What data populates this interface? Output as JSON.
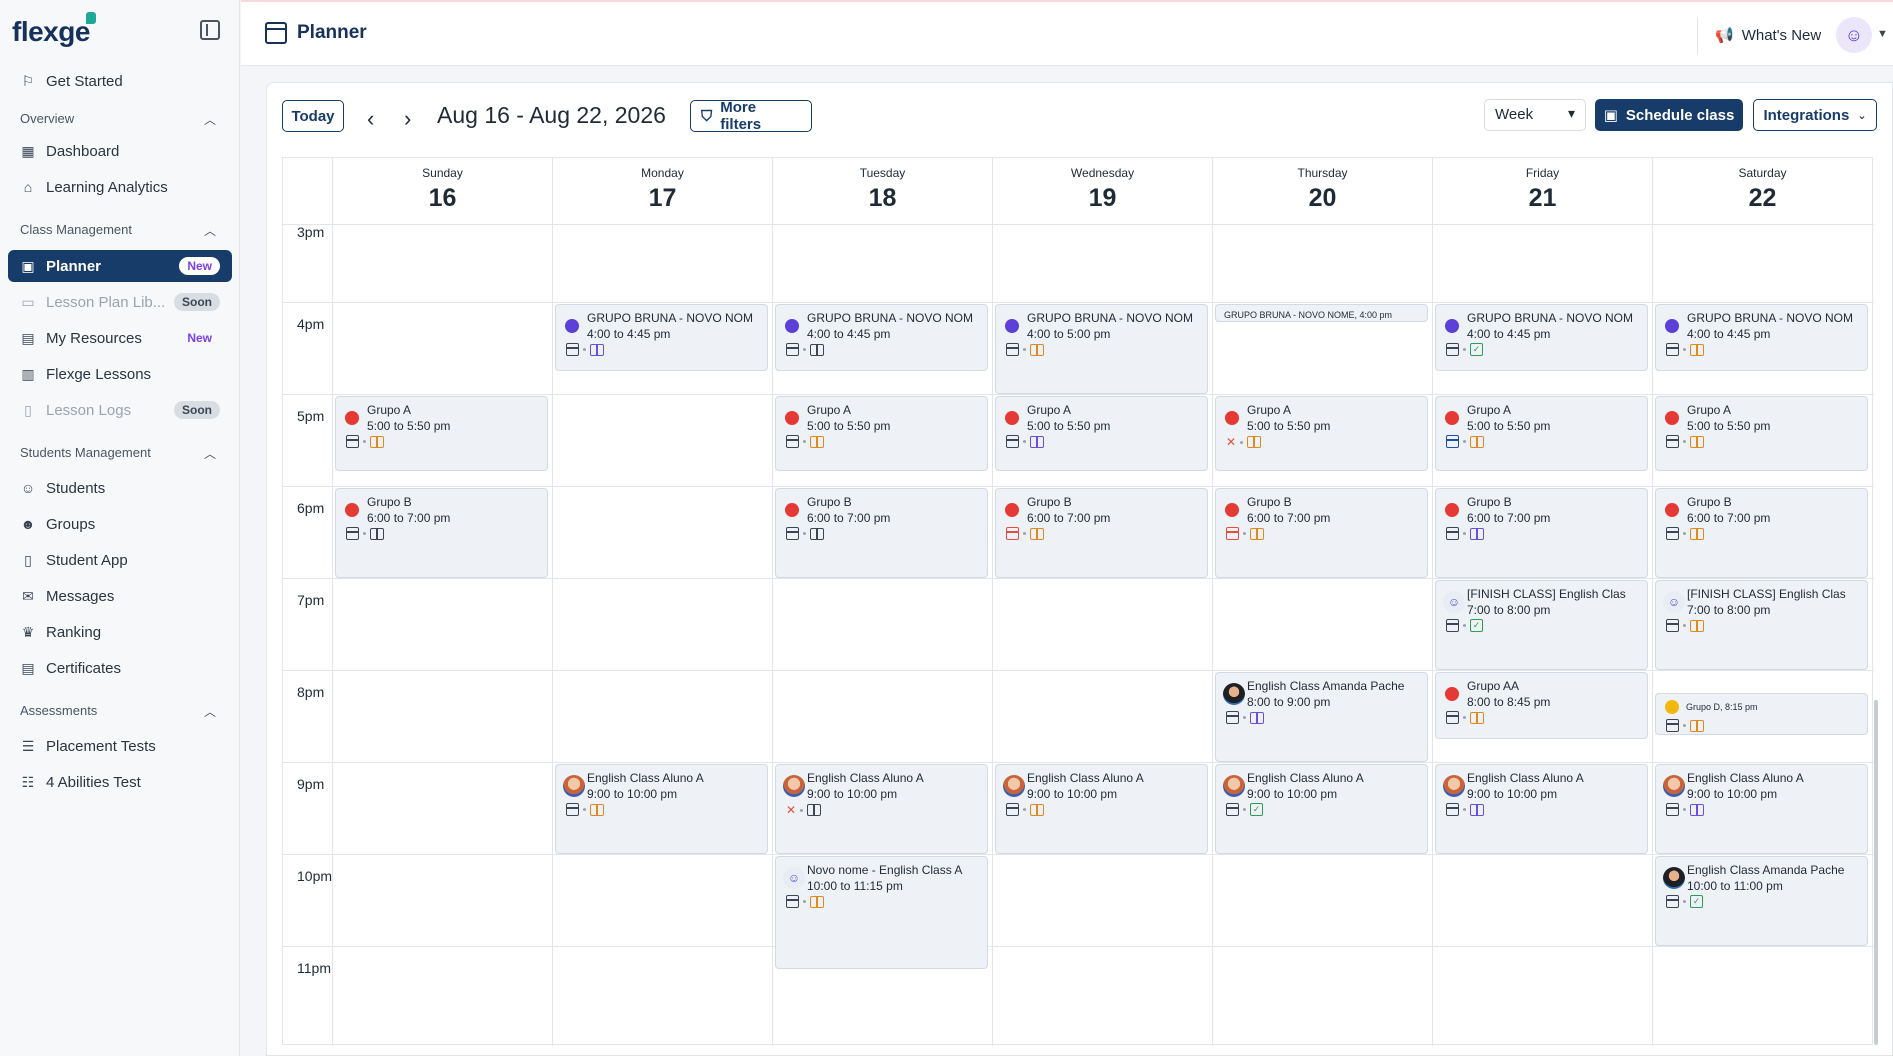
{
  "brand": {
    "name": "flexge"
  },
  "sidebar": {
    "get_started": "Get Started",
    "sections": [
      {
        "title": "Overview",
        "items": [
          {
            "label": "Dashboard"
          },
          {
            "label": "Learning Analytics"
          }
        ]
      },
      {
        "title": "Class Management",
        "items": [
          {
            "label": "Planner",
            "badge": "New",
            "active": true
          },
          {
            "label": "Lesson Plan Lib...",
            "badge": "Soon",
            "disabled": true
          },
          {
            "label": "My Resources",
            "badge": "New"
          },
          {
            "label": "Flexge Lessons"
          },
          {
            "label": "Lesson Logs",
            "badge": "Soon",
            "disabled": true
          }
        ]
      },
      {
        "title": "Students Management",
        "items": [
          {
            "label": "Students"
          },
          {
            "label": "Groups"
          },
          {
            "label": "Student App"
          },
          {
            "label": "Messages"
          },
          {
            "label": "Ranking"
          },
          {
            "label": "Certificates"
          }
        ]
      },
      {
        "title": "Assessments",
        "items": [
          {
            "label": "Placement Tests"
          },
          {
            "label": "4 Abilities Test"
          }
        ]
      }
    ]
  },
  "header": {
    "title": "Planner",
    "whats_new": "What's New"
  },
  "toolbar": {
    "today": "Today",
    "date_range": "Aug 16 - Aug 22, 2026",
    "more_filters": "More filters",
    "view": "Week",
    "schedule": "Schedule class",
    "integrations": "Integrations"
  },
  "calendar": {
    "days": [
      {
        "weekday": "Sunday",
        "date": "16"
      },
      {
        "weekday": "Monday",
        "date": "17"
      },
      {
        "weekday": "Tuesday",
        "date": "18"
      },
      {
        "weekday": "Wednesday",
        "date": "19"
      },
      {
        "weekday": "Thursday",
        "date": "20"
      },
      {
        "weekday": "Friday",
        "date": "21"
      },
      {
        "weekday": "Saturday",
        "date": "22"
      }
    ],
    "hours": [
      "3pm",
      "4pm",
      "5pm",
      "6pm",
      "7pm",
      "8pm",
      "9pm",
      "10pm",
      "11pm"
    ],
    "colors": {
      "purple": "#5b3fd6",
      "red": "#e53935",
      "yellow": "#f1b90f"
    },
    "events": [
      {
        "day": 1,
        "title": "GRUPO BRUNA - NOVO NOM",
        "time": "4:00 to 4:45 pm",
        "marker": "purple",
        "book": "purple"
      },
      {
        "day": 2,
        "title": "GRUPO BRUNA - NOVO NOM",
        "time": "4:00 to 4:45 pm",
        "marker": "purple",
        "book": "gray"
      },
      {
        "day": 3,
        "title": "GRUPO BRUNA - NOVO NOM",
        "time": "4:00 to 5:00 pm",
        "marker": "purple",
        "book": "orange"
      },
      {
        "day": 4,
        "title": "GRUPO BRUNA - NOVO NOME, 4:00 pm",
        "small": true
      },
      {
        "day": 5,
        "title": "GRUPO BRUNA - NOVO NOM",
        "time": "4:00 to 4:45 pm",
        "marker": "purple",
        "book": "check"
      },
      {
        "day": 6,
        "title": "GRUPO BRUNA - NOVO NOM",
        "time": "4:00 to 4:45 pm",
        "marker": "purple",
        "book": "orange"
      },
      {
        "day": 0,
        "title": "Grupo A",
        "time": "5:00 to 5:50 pm",
        "marker": "red",
        "book": "orange"
      },
      {
        "day": 2,
        "title": "Grupo A",
        "time": "5:00 to 5:50 pm",
        "marker": "red",
        "book": "orange"
      },
      {
        "day": 3,
        "title": "Grupo A",
        "time": "5:00 to 5:50 pm",
        "marker": "red",
        "book": "purple"
      },
      {
        "day": 4,
        "title": "Grupo A",
        "time": "5:00 to 5:50 pm",
        "marker": "red",
        "book": "orange",
        "first_icon": "xuser"
      },
      {
        "day": 5,
        "title": "Grupo A",
        "time": "5:00 to 5:50 pm",
        "marker": "red",
        "book": "orange",
        "first_icon": "calblue"
      },
      {
        "day": 6,
        "title": "Grupo A",
        "time": "5:00 to 5:50 pm",
        "marker": "red",
        "book": "orange"
      },
      {
        "day": 0,
        "title": "Grupo B",
        "time": "6:00 to 7:00 pm",
        "marker": "red",
        "book": "gray"
      },
      {
        "day": 2,
        "title": "Grupo B",
        "time": "6:00 to 7:00 pm",
        "marker": "red",
        "book": "gray"
      },
      {
        "day": 3,
        "title": "Grupo B",
        "time": "6:00 to 7:00 pm",
        "marker": "red",
        "book": "orange",
        "first_icon": "calred"
      },
      {
        "day": 4,
        "title": "Grupo B",
        "time": "6:00 to 7:00 pm",
        "marker": "red",
        "book": "orange",
        "first_icon": "calred"
      },
      {
        "day": 5,
        "title": "Grupo B",
        "time": "6:00 to 7:00 pm",
        "marker": "red",
        "book": "purple"
      },
      {
        "day": 6,
        "title": "Grupo B",
        "time": "6:00 to 7:00 pm",
        "marker": "red",
        "book": "orange"
      },
      {
        "day": 5,
        "title": "[FINISH CLASS] English Clas",
        "time": "7:00 to 8:00 pm",
        "marker": "person",
        "book": "check"
      },
      {
        "day": 6,
        "title": "[FINISH CLASS] English Clas",
        "time": "7:00 to 8:00 pm",
        "marker": "person",
        "book": "orange"
      },
      {
        "day": 4,
        "title": "English Class Amanda Pache",
        "time": "8:00 to 9:00 pm",
        "marker": "avatar-dark",
        "book": "purple"
      },
      {
        "day": 5,
        "title": "Grupo AA",
        "time": "8:00 to 8:45 pm",
        "marker": "red",
        "book": "orange"
      },
      {
        "day": 6,
        "title": "Grupo D, 8:15 pm",
        "marker": "yellow",
        "book": "orange",
        "small_dot": true
      },
      {
        "day": 1,
        "title": "English Class Aluno A",
        "time": "9:00 to 10:00 pm",
        "marker": "avatar",
        "book": "orange"
      },
      {
        "day": 2,
        "title": "English Class Aluno A",
        "time": "9:00 to 10:00 pm",
        "marker": "avatar",
        "book": "gray",
        "first_icon": "xuser"
      },
      {
        "day": 3,
        "title": "English Class Aluno A",
        "time": "9:00 to 10:00 pm",
        "marker": "avatar",
        "book": "orange"
      },
      {
        "day": 4,
        "title": "English Class Aluno A",
        "time": "9:00 to 10:00 pm",
        "marker": "avatar",
        "book": "check"
      },
      {
        "day": 5,
        "title": "English Class Aluno A",
        "time": "9:00 to 10:00 pm",
        "marker": "avatar",
        "book": "purple"
      },
      {
        "day": 6,
        "title": "English Class Aluno A",
        "time": "9:00 to 10:00 pm",
        "marker": "avatar",
        "book": "purple"
      },
      {
        "day": 2,
        "title": "Novo nome - English Class A",
        "time": "10:00 to 11:15 pm",
        "marker": "person",
        "book": "orange"
      },
      {
        "day": 6,
        "title": "English Class Amanda Pache",
        "time": "10:00 to 11:00 pm",
        "marker": "avatar-dark",
        "book": "check"
      }
    ]
  }
}
